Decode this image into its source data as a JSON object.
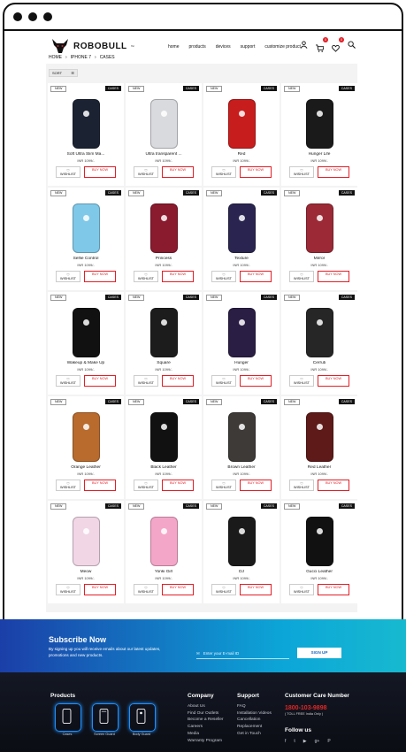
{
  "brand": {
    "name": "ROBOBULL",
    "tm": "™"
  },
  "nav": [
    "home",
    "products",
    "devices",
    "support",
    "customize product"
  ],
  "header_icons": {
    "cart_count": "0",
    "wishlist_count": "0"
  },
  "breadcrumb": [
    "HOME",
    "IPHONE 7",
    "CASES"
  ],
  "sort_label": "SORT",
  "card_labels": {
    "new": "NEW",
    "cases": "CASES",
    "wishlist": "WISHLIST",
    "buy": "BUY NOW"
  },
  "products": [
    {
      "name": "Soft Ultra Slim Ma...",
      "price": "INR 1099/-",
      "color": "#1b2333"
    },
    {
      "name": "Ultra transparent ...",
      "price": "INR 1099/-",
      "color": "#d9dade"
    },
    {
      "name": "Red",
      "price": "INR 1099/-",
      "color": "#c81d1d"
    },
    {
      "name": "Hunger Life",
      "price": "INR 1099/-",
      "color": "#1a1a1a"
    },
    {
      "name": "Selfie Control",
      "price": "INR 1099/-",
      "color": "#7fc8e8"
    },
    {
      "name": "Princess",
      "price": "INR 1099/-",
      "color": "#8a1a2e"
    },
    {
      "name": "Texture",
      "price": "INR 1099/-",
      "color": "#2a2550"
    },
    {
      "name": "Mirror",
      "price": "INR 1099/-",
      "color": "#9b2a36"
    },
    {
      "name": "Wakeup & Make Up",
      "price": "INR 1099/-",
      "color": "#111111"
    },
    {
      "name": "Square",
      "price": "INR 1099/-",
      "color": "#1c1c1c"
    },
    {
      "name": "Hunger",
      "price": "INR 1099/-",
      "color": "#2a1e45"
    },
    {
      "name": "Cerruti",
      "price": "INR 1099/-",
      "color": "#262626"
    },
    {
      "name": "Orange Leather",
      "price": "INR 1099/-",
      "color": "#b86b2d"
    },
    {
      "name": "Black Leather",
      "price": "INR 1099/-",
      "color": "#111111"
    },
    {
      "name": "Brown Leather",
      "price": "INR 1099/-",
      "color": "#3d3a37"
    },
    {
      "name": "Red Leather",
      "price": "INR 1099/-",
      "color": "#5e1a18"
    },
    {
      "name": "Meow",
      "price": "INR 1099/-",
      "color": "#f1d6e6"
    },
    {
      "name": "Yonki Girl",
      "price": "INR 1099/-",
      "color": "#f4a6c8"
    },
    {
      "name": "DJ",
      "price": "INR 1099/-",
      "color": "#1a1a1a"
    },
    {
      "name": "Gucci Leather",
      "price": "INR 1099/-",
      "color": "#111111"
    }
  ],
  "subscribe": {
    "title": "Subscribe Now",
    "desc": "By signing up you will receive emails about our latest updates, promotions and new products.",
    "placeholder": "Enter your E-mail ID",
    "button": "SIGN UP"
  },
  "footer": {
    "products_title": "Products",
    "product_cats": [
      "Cases",
      "Screen Guard",
      "Body Guard"
    ],
    "company_title": "Company",
    "company_links": [
      "About Us",
      "Find Our Outlets",
      "Become a Reseller",
      "Careers",
      "Media",
      "Warranty Program"
    ],
    "support_title": "Support",
    "support_links": [
      "FAQ",
      "Installation Videos",
      "Cancellation",
      "Replacement",
      "Get in Touch"
    ],
    "care_title": "Customer Care Number",
    "care_number": "1800-103-9898",
    "tollfree": "( TOLL FREE India Only )",
    "follow_title": "Follow us",
    "social": [
      "f",
      "t",
      "▶",
      "g+",
      "P"
    ]
  },
  "colors": {
    "accent": "#e21f26",
    "subscribe_start": "#1b3fa8",
    "subscribe_end": "#17b9d0",
    "footer_bg": "#0b0d14"
  }
}
